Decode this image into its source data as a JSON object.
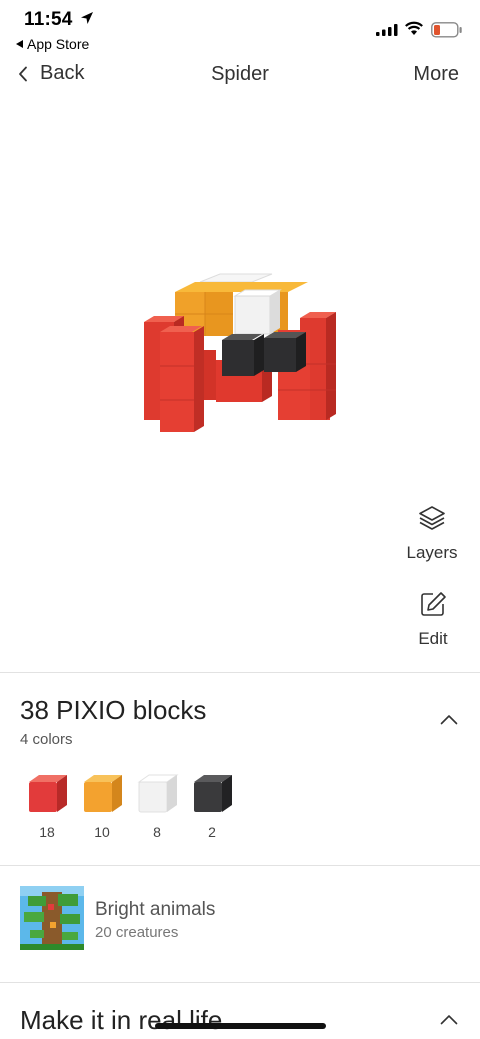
{
  "status_bar": {
    "time": "11:54",
    "back_app": "App Store",
    "icons": [
      "location-arrow-icon",
      "signal-icon",
      "wifi-icon",
      "battery-low-icon"
    ]
  },
  "nav": {
    "back_label": "Back",
    "title": "Spider",
    "more_label": "More"
  },
  "actions": {
    "layers_label": "Layers",
    "edit_label": "Edit"
  },
  "blocks": {
    "title": "38 PIXIO blocks",
    "subtitle": "4 colors",
    "colors": [
      {
        "name": "red",
        "hex": "#e23b3b",
        "count": "18"
      },
      {
        "name": "orange",
        "hex": "#f3a22f",
        "count": "10"
      },
      {
        "name": "white",
        "hex": "#f2f2f2",
        "count": "8"
      },
      {
        "name": "black",
        "hex": "#3a3a3c",
        "count": "2"
      }
    ]
  },
  "collection": {
    "name": "Bright animals",
    "subtitle": "20 creatures"
  },
  "real_life": {
    "title": "Make it in real life"
  }
}
